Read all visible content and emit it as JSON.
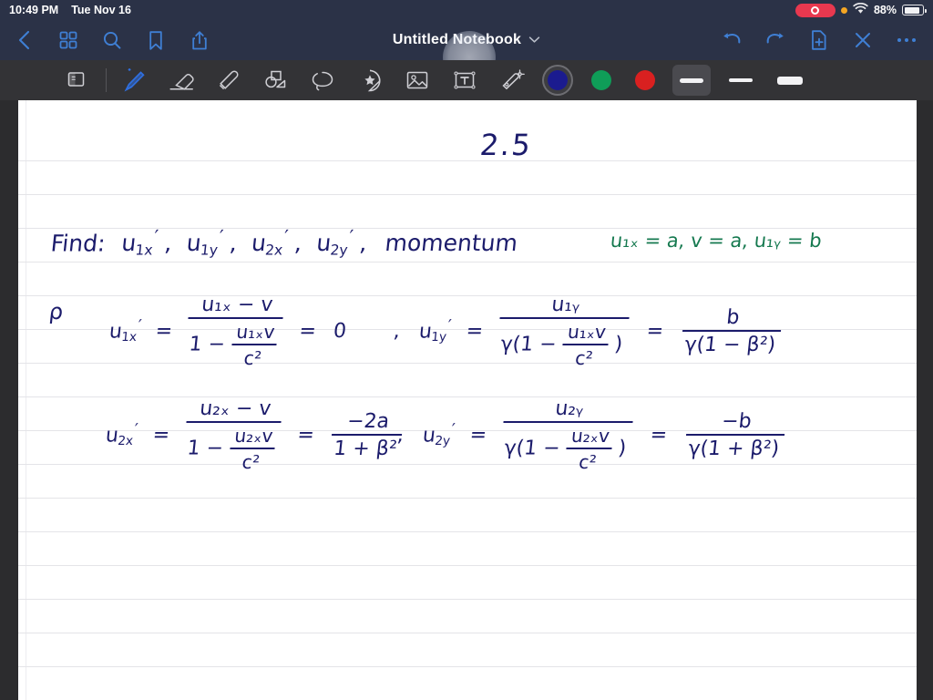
{
  "status_bar": {
    "time": "10:49 PM",
    "date": "Tue Nov 16",
    "battery_percent": "88%",
    "recording_label": "",
    "colors": {
      "background": "#2b3247",
      "recording_red": "#e8384f",
      "orange": "#f5a623"
    }
  },
  "nav_bar": {
    "title": "Untitled Notebook",
    "left_buttons": [
      {
        "name": "back-icon",
        "label": "Back"
      },
      {
        "name": "grid-icon",
        "label": "Page Grid"
      },
      {
        "name": "search-icon",
        "label": "Search"
      },
      {
        "name": "bookmark-icon",
        "label": "Bookmark"
      },
      {
        "name": "share-icon",
        "label": "Share"
      }
    ],
    "right_buttons": [
      {
        "name": "undo-icon",
        "label": "Undo"
      },
      {
        "name": "redo-icon",
        "label": "Redo"
      },
      {
        "name": "add-page-icon",
        "label": "New Page"
      },
      {
        "name": "close-icon",
        "label": "Close"
      },
      {
        "name": "more-icon",
        "label": "More"
      }
    ],
    "accent_color": "#3f7fd4"
  },
  "tool_bar": {
    "tools": [
      {
        "name": "page-layers-icon",
        "label": "Page Layers",
        "active": false
      },
      {
        "name": "pen-icon",
        "label": "Pen",
        "active": true
      },
      {
        "name": "eraser-icon",
        "label": "Eraser",
        "active": false
      },
      {
        "name": "highlighter-icon",
        "label": "Highlighter",
        "active": false
      },
      {
        "name": "shapes-icon",
        "label": "Shapes",
        "active": false
      },
      {
        "name": "lasso-icon",
        "label": "Lasso",
        "active": false
      },
      {
        "name": "sticker-icon",
        "label": "Sticker",
        "active": false
      },
      {
        "name": "image-icon",
        "label": "Image",
        "active": false
      },
      {
        "name": "text-box-icon",
        "label": "Text Box",
        "active": false
      },
      {
        "name": "magic-wand-icon",
        "label": "Magic Wand",
        "active": false
      }
    ],
    "colors": [
      {
        "name": "color-swatch-navy",
        "hex": "#1b1b8f",
        "selected": true
      },
      {
        "name": "color-swatch-green",
        "hex": "#0f9d58",
        "selected": false
      },
      {
        "name": "color-swatch-red",
        "hex": "#d92020",
        "selected": false
      }
    ],
    "stroke_widths": [
      {
        "name": "stroke-width-thin",
        "selected": true
      },
      {
        "name": "stroke-width-medium",
        "selected": false
      },
      {
        "name": "stroke-width-thick",
        "selected": false
      }
    ],
    "active_pen_color": "#2f6fe0",
    "background": "#333336"
  },
  "notebook": {
    "page_title": "2.5",
    "ink_color": "#1b1b6b",
    "accent_ink_color": "#15794f",
    "lines": {
      "find_prefix": "Find:",
      "find_terms": [
        "u",
        "u",
        "u",
        "u"
      ],
      "find_last": "momentum",
      "givens": "u₁ₓ = a,  v = a,  u₁ᵧ = b",
      "rho_label": "ρ",
      "eq1_lhs": "u₁ₓ′",
      "eq1_num": "u₁ₓ − v",
      "eq1_den_lead": "1 −",
      "eq1_den_num": "u₁ₓv",
      "eq1_den_den": "c²",
      "eq1_result": "0",
      "eq2_lhs": "u₁ᵧ′",
      "eq2_num": "u₁ᵧ",
      "eq2_den_lead": "γ(1 −",
      "eq2_den_num": "u₁ₓv",
      "eq2_den_den": "c²",
      "eq2_den_tail": ")",
      "eq2_res_num": "b",
      "eq2_res_den": "γ(1 − β²)",
      "eq3_lhs": "u₂ₓ′",
      "eq3_num": "u₂ₓ − v",
      "eq3_den_lead": "1 −",
      "eq3_den_num": "u₂ₓv",
      "eq3_den_den": "c²",
      "eq3_res_num": "−2a",
      "eq3_res_den": "1 + β²",
      "eq4_lhs": "u₂ᵧ′",
      "eq4_num": "u₂ᵧ",
      "eq4_den_lead": "γ(1 −",
      "eq4_den_num": "u₂ₓv",
      "eq4_den_den": "c²",
      "eq4_den_tail": ")",
      "eq4_res_num": "−b",
      "eq4_res_den": "γ(1 + β²)",
      "equals": "=",
      "comma": ","
    }
  }
}
